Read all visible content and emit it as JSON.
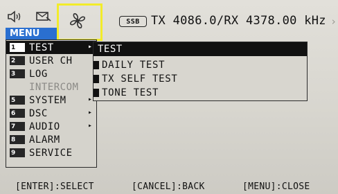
{
  "status_bar": {
    "icons": [
      "speaker-icon",
      "mail-icon",
      "fan-icon"
    ],
    "highlight_color": "#f2ec2a",
    "mode": "SSB",
    "frequency": "TX 4086.0/RX 4378.00 kHz",
    "edge_mark": "›"
  },
  "menu": {
    "title": "MENU",
    "items": [
      {
        "num": "1",
        "label": "TEST",
        "arrow": "▸",
        "selected": true
      },
      {
        "num": "2",
        "label": "USER CH",
        "arrow": ""
      },
      {
        "num": "3",
        "label": "LOG",
        "arrow": ""
      },
      {
        "num": "",
        "label": "INTERCOM",
        "arrow": "",
        "disabled": true
      },
      {
        "num": "5",
        "label": "SYSTEM",
        "arrow": "▸"
      },
      {
        "num": "6",
        "label": "DSC",
        "arrow": "▸"
      },
      {
        "num": "7",
        "label": "AUDIO",
        "arrow": "▸"
      },
      {
        "num": "8",
        "label": "ALARM",
        "arrow": ""
      },
      {
        "num": "9",
        "label": "SERVICE",
        "arrow": ""
      }
    ]
  },
  "submenu": {
    "title": "TEST",
    "items": [
      {
        "label": "DAILY TEST"
      },
      {
        "label": "TX SELF TEST"
      },
      {
        "label": "TONE TEST"
      }
    ]
  },
  "footer": {
    "enter": "[ENTER]:SELECT",
    "cancel": "[CANCEL]:BACK",
    "menu": "[MENU]:CLOSE"
  },
  "colors": {
    "menu_title_bg": "#2a6fd0",
    "selected_bg": "#111111",
    "disabled_text": "#8b8a86"
  }
}
